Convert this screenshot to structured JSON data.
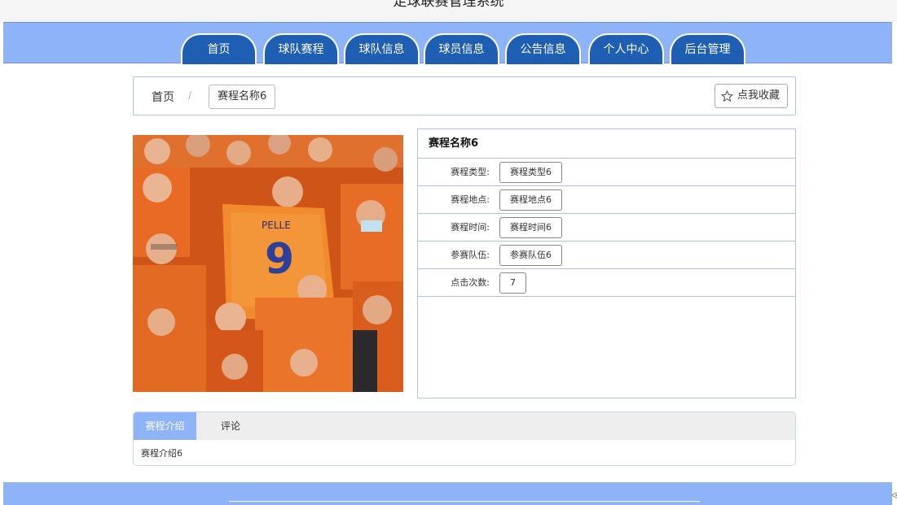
{
  "app": {
    "title": "足球联赛管理系统"
  },
  "nav": {
    "items": [
      {
        "label": "首页"
      },
      {
        "label": "球队赛程"
      },
      {
        "label": "球队信息"
      },
      {
        "label": "球员信息"
      },
      {
        "label": "公告信息"
      },
      {
        "label": "个人中心"
      },
      {
        "label": "后台管理"
      }
    ]
  },
  "breadcrumb": {
    "home": "首页",
    "separator": "/",
    "current": "赛程名称6"
  },
  "favorite": {
    "label": "点我收藏",
    "icon": "star-icon"
  },
  "photo": {
    "jersey_name": "PELLE",
    "jersey_number": "9"
  },
  "detail": {
    "title": "赛程名称6",
    "rows": [
      {
        "label": "赛程类型:",
        "value": "赛程类型6"
      },
      {
        "label": "赛程地点:",
        "value": "赛程地点6"
      },
      {
        "label": "赛程时间:",
        "value": "赛程时间6"
      },
      {
        "label": "参赛队伍:",
        "value": "参赛队伍6"
      },
      {
        "label": "点击次数:",
        "value": "7"
      }
    ]
  },
  "tabs": {
    "items": [
      {
        "label": "赛程介绍"
      },
      {
        "label": "评论"
      }
    ],
    "content": "赛程介绍6"
  },
  "footer": {
    "side_arrow": "≪"
  },
  "colors": {
    "nav_bg": "#8fb3f7",
    "nav_tab": "#1f5fb3",
    "border": "#a9c2ea"
  }
}
